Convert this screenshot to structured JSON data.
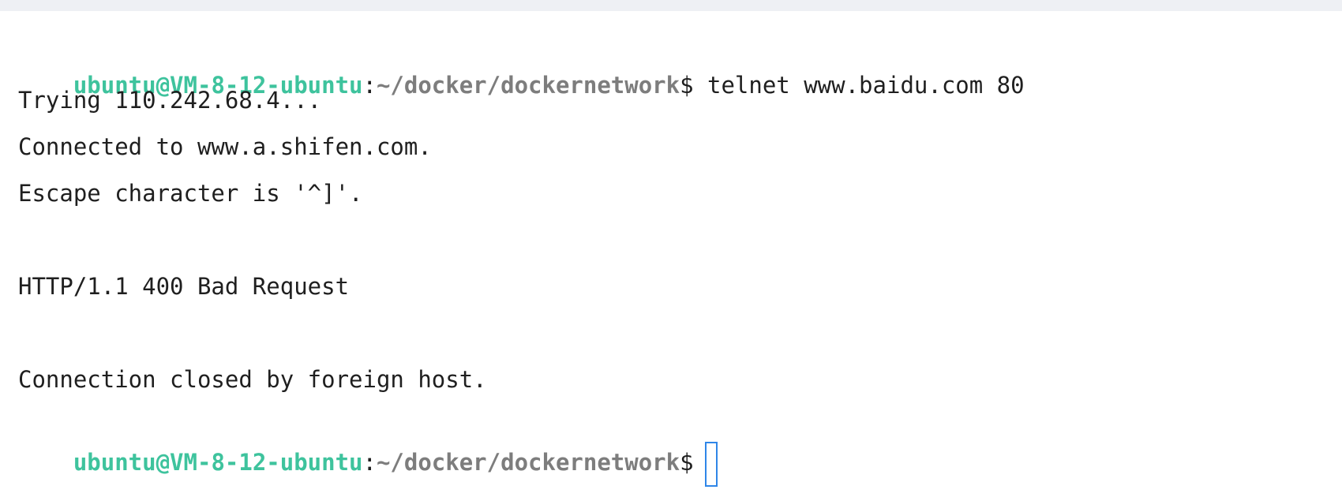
{
  "terminal": {
    "prompt": {
      "user_host": "ubuntu@VM-8-12-ubuntu",
      "colon": ":",
      "path": "~/docker/dockernetwork",
      "symbol": "$"
    },
    "command": " telnet www.baidu.com 80",
    "output": {
      "line1": "Trying 110.242.68.4...",
      "line2": "Connected to www.a.shifen.com.",
      "line3": "Escape character is '^]'.",
      "line4": "HTTP/1.1 400 Bad Request",
      "line5": "Connection closed by foreign host."
    },
    "colors": {
      "user": "#3ec39d",
      "path": "#7d7d7d",
      "cursor": "#2f86e8"
    }
  }
}
